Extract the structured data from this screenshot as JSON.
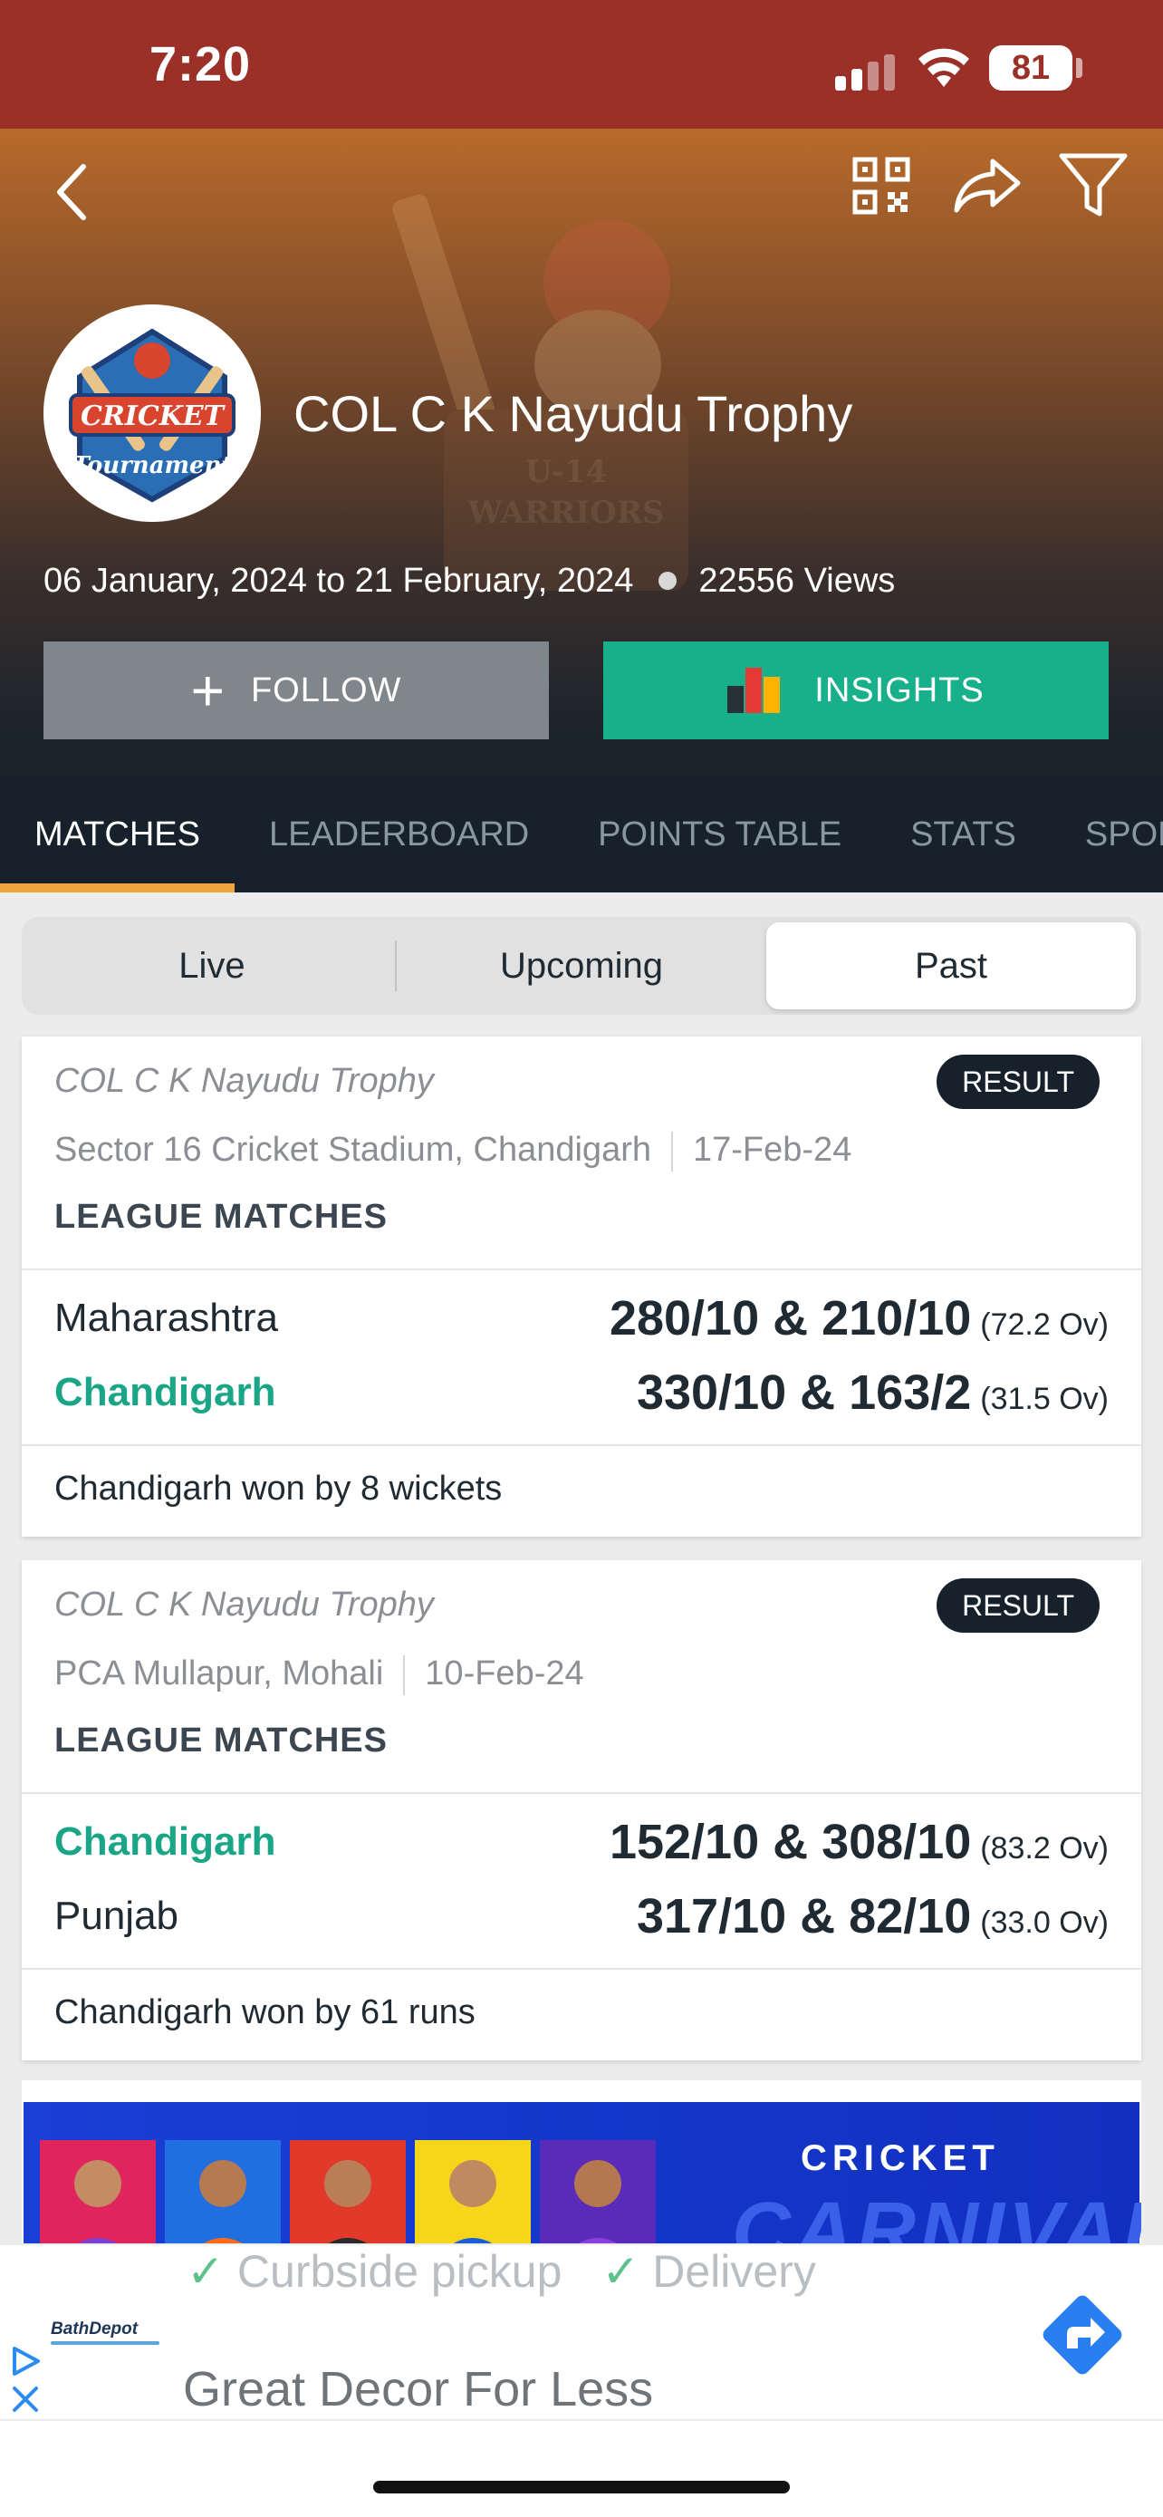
{
  "status_bar": {
    "time": "7:20",
    "battery": "81"
  },
  "header": {
    "title": "COL C K Nayudu Trophy",
    "dates": "06 January, 2024 to 21 February, 2024",
    "views": "22556 Views",
    "follow_label": "FOLLOW",
    "insights_label": "INSIGHTS",
    "logo_text_top": "CRICKET",
    "logo_text_bottom": "Tournament",
    "hero_art_text": "U-14 WARRIORS"
  },
  "tabs": [
    {
      "label": "MATCHES",
      "active": true
    },
    {
      "label": "LEADERBOARD",
      "active": false
    },
    {
      "label": "POINTS TABLE",
      "active": false
    },
    {
      "label": "STATS",
      "active": false
    },
    {
      "label": "SPONSORS",
      "active": false
    }
  ],
  "segments": {
    "live": "Live",
    "upcoming": "Upcoming",
    "past": "Past",
    "selected": "Past"
  },
  "matches": [
    {
      "tournament": "COL C K Nayudu Trophy",
      "badge": "RESULT",
      "venue": "Sector 16 Cricket Stadium, Chandigarh",
      "date": "17-Feb-24",
      "stage": "LEAGUE MATCHES",
      "team1": {
        "name": "Maharashtra",
        "score": "280/10 & 210/10",
        "overs": "(72.2 Ov)",
        "winner": false
      },
      "team2": {
        "name": "Chandigarh",
        "score": "330/10 & 163/2",
        "overs": "(31.5 Ov)",
        "winner": true
      },
      "result": "Chandigarh won by 8 wickets"
    },
    {
      "tournament": "COL C K Nayudu Trophy",
      "badge": "RESULT",
      "venue": "PCA Mullapur, Mohali",
      "date": "10-Feb-24",
      "stage": "LEAGUE MATCHES",
      "team1": {
        "name": "Chandigarh",
        "score": "152/10 & 308/10",
        "overs": "(83.2 Ov)",
        "winner": true
      },
      "team2": {
        "name": "Punjab",
        "score": "317/10 & 82/10",
        "overs": "(33.0 Ov)",
        "winner": false
      },
      "result": "Chandigarh won by 61 runs"
    }
  ],
  "promo": {
    "title": "CRICKET",
    "subtitle": "CARNIVAL"
  },
  "ad": {
    "feature1": "Curbside pickup",
    "feature2": "Delivery",
    "brand": "BathDepot",
    "headline": "Great Decor For Less"
  },
  "colors": {
    "status_bar": "#9b3028",
    "tab_bar": "#17212b",
    "tab_indicator": "#f0a43a",
    "insights": "#17b08a",
    "winner_text": "#1aa586",
    "follow": "#7f868c"
  }
}
